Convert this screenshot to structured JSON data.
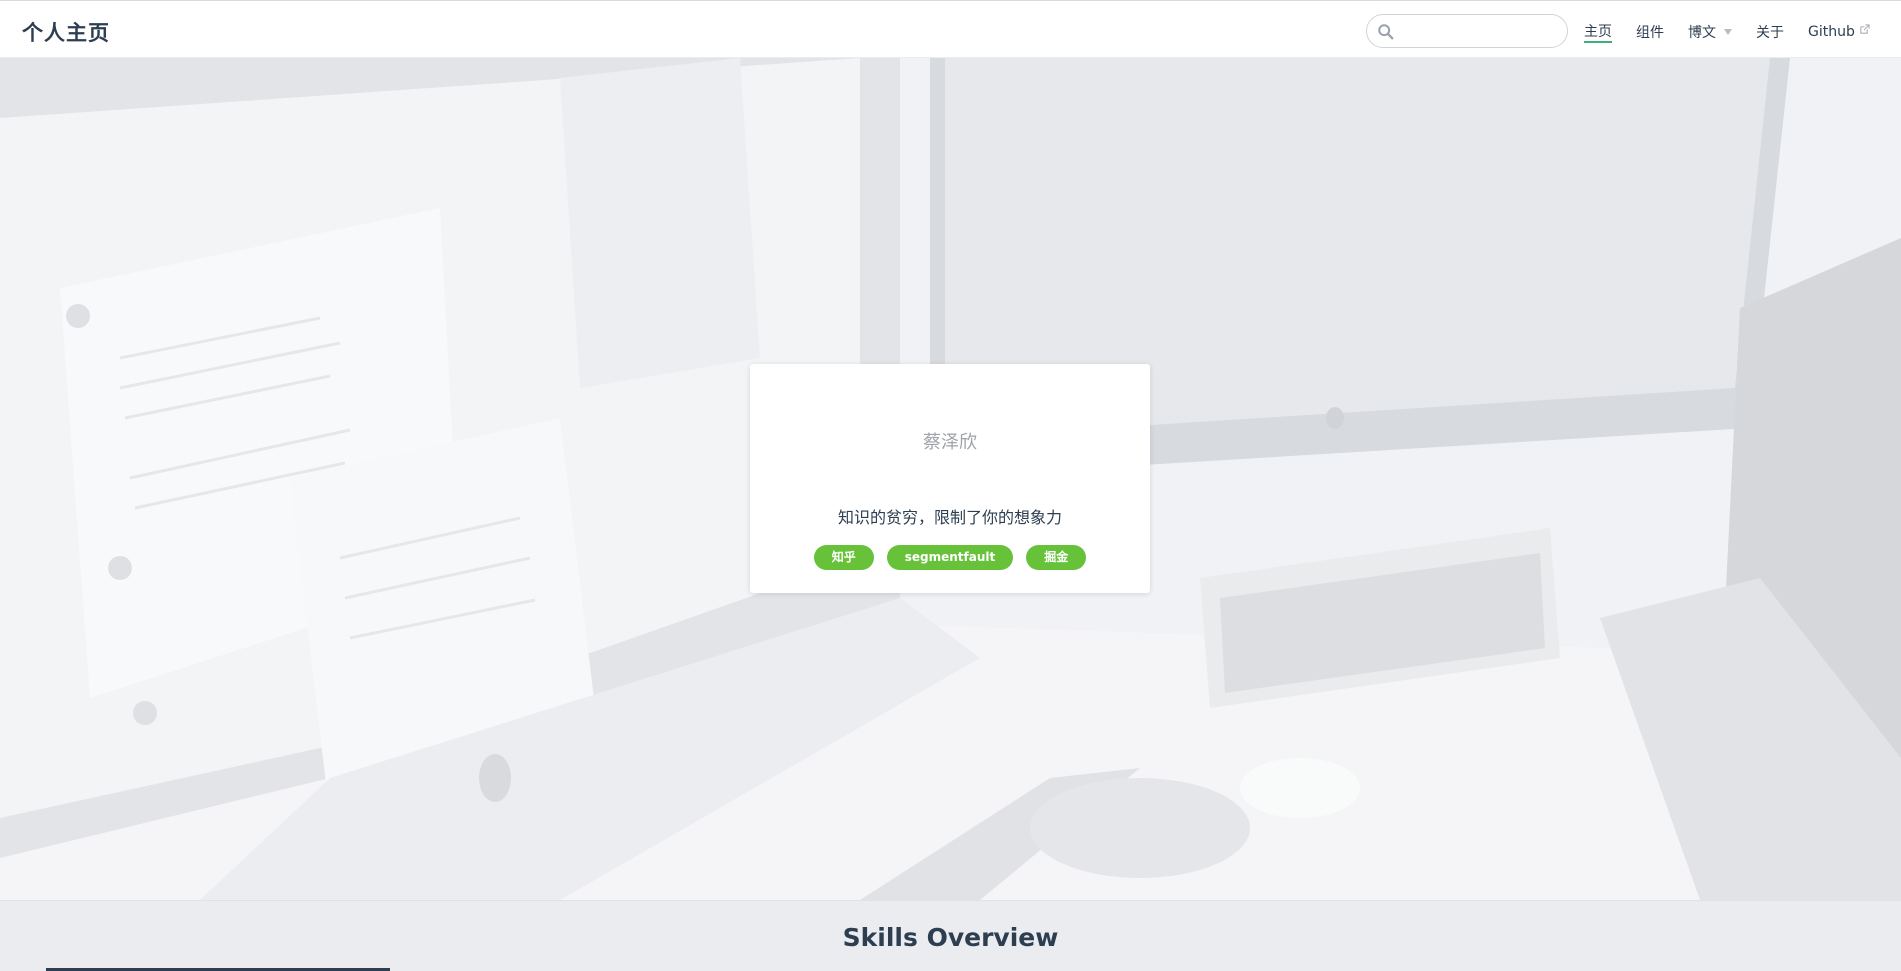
{
  "navbar": {
    "site_name": "个人主页",
    "search": {
      "placeholder": "",
      "value": ""
    },
    "links": [
      {
        "label": "主页",
        "active": true
      },
      {
        "label": "组件"
      },
      {
        "label": "博文",
        "has_dropdown": true
      },
      {
        "label": "关于"
      },
      {
        "label": "Github",
        "external": true
      }
    ]
  },
  "hero": {
    "name": "蔡泽欣",
    "motto": "知识的贫穷，限制了你的想象力",
    "links": [
      "知乎",
      "segmentfault",
      "掘金"
    ]
  },
  "skills": {
    "title": "Skills Overview"
  },
  "colors": {
    "accent": "#3eaf7c",
    "pill": "#67c23a",
    "text": "#2c3e50"
  }
}
